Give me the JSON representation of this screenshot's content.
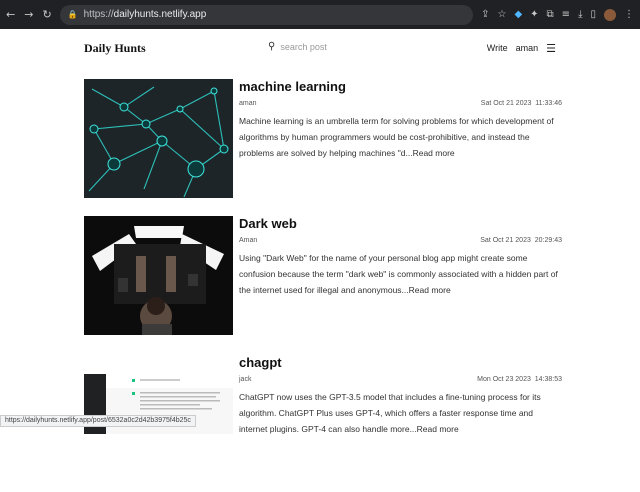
{
  "browser": {
    "url_prefix": "https://",
    "url_host": "dailyhunts.netlify.app"
  },
  "site": {
    "logo": "Daily Hunts",
    "search_placeholder": "search post",
    "write_label": "Write",
    "user_label": "aman"
  },
  "posts": [
    {
      "title": "machine learning",
      "author": "aman",
      "date": "Sat Oct 21 2023",
      "time": "11:33:46",
      "excerpt": "Machine learning is an umbrella term for solving problems for which development of algorithms by human programmers would be cost-prohibitive, and instead the problems are solved by helping machines \"d...",
      "read_more": "Read more"
    },
    {
      "title": "Dark web",
      "author": "Aman",
      "date": "Sat Oct 21 2023",
      "time": "20:29:43",
      "excerpt": "Using \"Dark Web\" for the name of your personal blog app might create some confusion because the term \"dark web\" is commonly associated with a hidden part of the internet used for illegal and anonymous...",
      "read_more": "Read more"
    },
    {
      "title": "chagpt",
      "author": "jack",
      "date": "Mon Oct 23 2023",
      "time": "14:38:53",
      "excerpt": "ChatGPT now uses the GPT-3.5 model that includes a fine-tuning process for its algorithm. ChatGPT Plus uses GPT-4, which offers a faster response time and internet plugins. GPT-4 can also handle more...",
      "read_more": "Read more"
    }
  ],
  "status_bar": {
    "text": "https://dailyhunts.netlify.app/post/6532a0c2d42b3975f4b25c"
  }
}
